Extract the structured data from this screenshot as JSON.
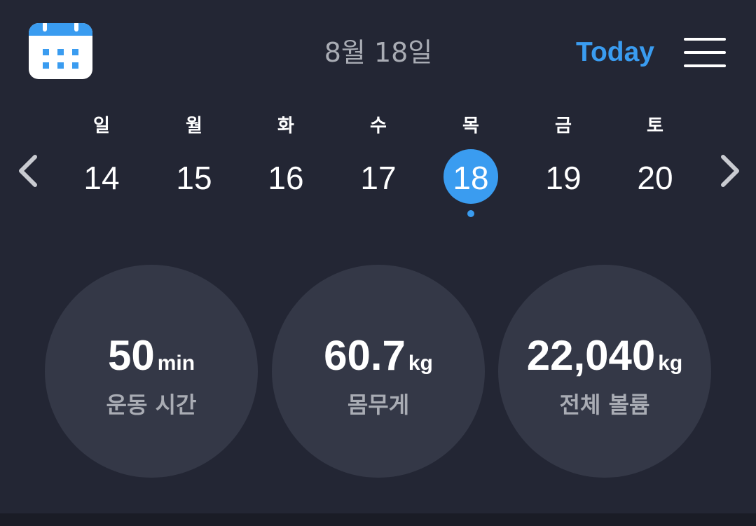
{
  "header": {
    "calendar_icon": "calendar-icon",
    "date_title": "8월 18일",
    "today_label": "Today",
    "menu_icon": "hamburger-menu-icon"
  },
  "week": {
    "prev_icon": "chevron-left-icon",
    "next_icon": "chevron-right-icon",
    "days": [
      {
        "name": "일",
        "num": "14"
      },
      {
        "name": "월",
        "num": "15"
      },
      {
        "name": "화",
        "num": "16"
      },
      {
        "name": "수",
        "num": "17"
      },
      {
        "name": "목",
        "num": "18"
      },
      {
        "name": "금",
        "num": "19"
      },
      {
        "name": "토",
        "num": "20"
      }
    ],
    "selected_day": "18"
  },
  "stats": [
    {
      "value": "50",
      "unit": "min",
      "label": "운동 시간"
    },
    {
      "value": "60.7",
      "unit": "kg",
      "label": "몸무게"
    },
    {
      "value": "22,040",
      "unit": "kg",
      "label": "전체 볼륨"
    }
  ],
  "colors": {
    "background": "#232634",
    "accent": "#3a9cf0",
    "circle": "#343847",
    "muted_text": "#a9acb4"
  }
}
